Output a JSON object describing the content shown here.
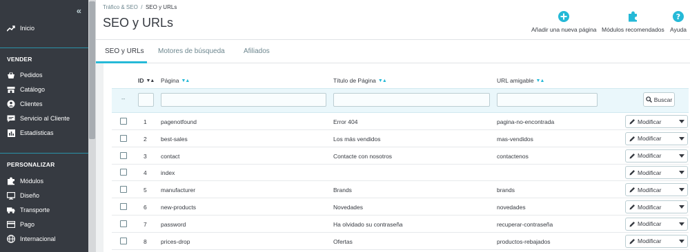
{
  "sidebar": {
    "home_label": "Inicio",
    "section_sell": "VENDER",
    "sell_items": [
      {
        "label": "Pedidos",
        "icon": "cart-icon"
      },
      {
        "label": "Catálogo",
        "icon": "store-icon"
      },
      {
        "label": "Clientes",
        "icon": "user-icon"
      },
      {
        "label": "Servicio al Cliente",
        "icon": "chat-icon"
      },
      {
        "label": "Estadísticas",
        "icon": "bar-chart-icon"
      }
    ],
    "section_customize": "PERSONALIZAR",
    "customize_items": [
      {
        "label": "Módulos",
        "icon": "puzzle-icon"
      },
      {
        "label": "Diseño",
        "icon": "desktop-icon"
      },
      {
        "label": "Transporte",
        "icon": "truck-icon"
      },
      {
        "label": "Pago",
        "icon": "credit-card-icon"
      },
      {
        "label": "Internacional",
        "icon": "globe-icon"
      }
    ]
  },
  "header": {
    "breadcrumb_parent": "Tráfico & SEO",
    "breadcrumb_sep": "/",
    "breadcrumb_current": "SEO y URLs",
    "title": "SEO y URLs",
    "toolbar": {
      "add_page": "Añadir una nueva página",
      "recommended_modules": "Módulos recomendados",
      "help": "Ayuda"
    }
  },
  "tabs": [
    {
      "label": "SEO y URLs",
      "active": true
    },
    {
      "label": "Motores de búsqueda",
      "active": false
    },
    {
      "label": "Afiliados",
      "active": false
    }
  ],
  "table": {
    "columns": {
      "id": "ID",
      "page": "Página",
      "title": "Título de Página",
      "url": "URL amigable"
    },
    "sort_glyph": "▼▲",
    "filter_dash": "--",
    "search_button": "Buscar",
    "modify_label": "Modificar",
    "rows": [
      {
        "id": "1",
        "page": "pagenotfound",
        "title": "Error 404",
        "url": "pagina-no-encontrada"
      },
      {
        "id": "2",
        "page": "best-sales",
        "title": "Los más vendidos",
        "url": "mas-vendidos"
      },
      {
        "id": "3",
        "page": "contact",
        "title": "Contacte con nosotros",
        "url": "contactenos"
      },
      {
        "id": "4",
        "page": "index",
        "title": "",
        "url": ""
      },
      {
        "id": "5",
        "page": "manufacturer",
        "title": "Brands",
        "url": "brands"
      },
      {
        "id": "6",
        "page": "new-products",
        "title": "Novedades",
        "url": "novedades"
      },
      {
        "id": "7",
        "page": "password",
        "title": "Ha olvidado su contraseña",
        "url": "recuperar-contraseña"
      },
      {
        "id": "8",
        "page": "prices-drop",
        "title": "Ofertas",
        "url": "productos-rebajados"
      }
    ]
  },
  "colors": {
    "sidebar_bg": "#363a41",
    "accent": "#25b9d7",
    "text": "#363a41"
  }
}
